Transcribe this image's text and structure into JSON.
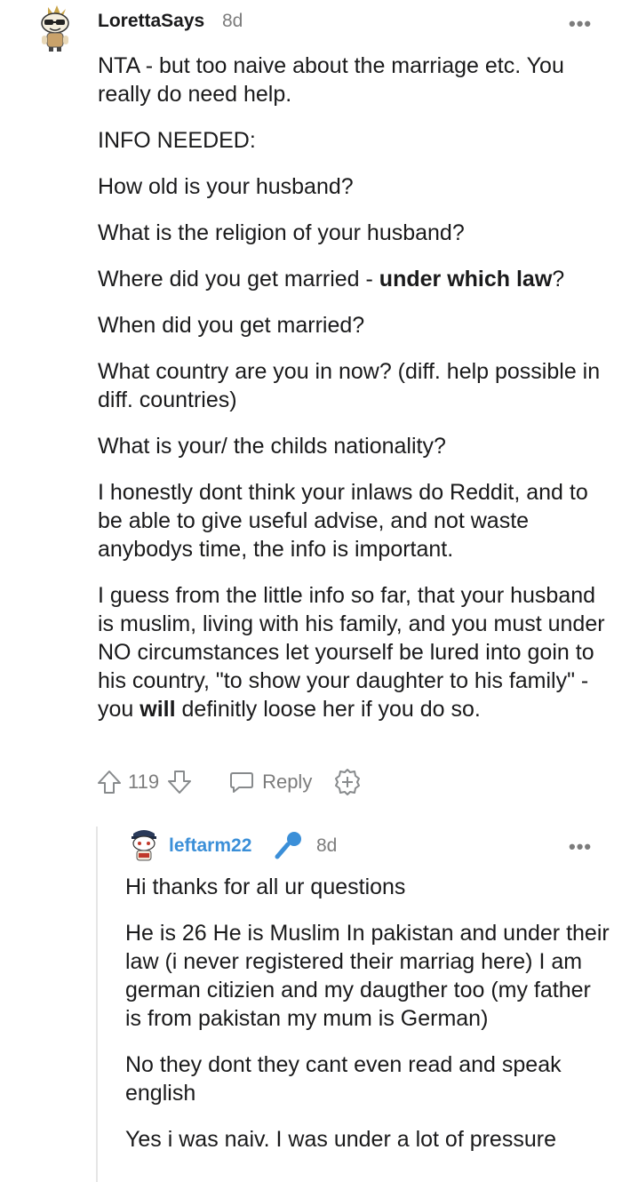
{
  "comment": {
    "author": "LorettaSays",
    "age": "8d",
    "more_label": "•••",
    "paragraphs": [
      "NTA - but too naive about the marriage etc. You really do need help.",
      "INFO NEEDED:",
      "How old is your husband?",
      "What is the religion of your husband?",
      {
        "before": "Where did you get married - ",
        "bold": "under which law",
        "after": "?"
      },
      "When did you get married?",
      "What country are you in now? (diff. help possible in diff. countries)",
      "What is your/ the childs nationality?",
      "I honestly dont think your inlaws do Reddit, and to be able to give useful advise, and not waste anybodys time, the info is important.",
      {
        "before": "I guess from the little info so far, that your husband is muslim, living with his family, and you must under NO circumstances let yourself be lured into goin to his country, \"to show your daughter to his family\" - you ",
        "bold": "will",
        "after": " definitly loose her if you do so."
      }
    ],
    "score": "119",
    "reply_label": "Reply",
    "icons": [
      "upvote-icon",
      "downvote-icon",
      "reply-icon",
      "award-icon"
    ]
  },
  "reply_comment": {
    "author": "leftarm22",
    "age": "8d",
    "more_label": "•••",
    "flair_icon": "microphone-icon",
    "paragraphs": [
      "Hi thanks for all ur questions",
      "He is 26 He is Muslim In pakistan and under their law (i never registered their marriag here) I am german citizien and my daugther too (my father is from pakistan my mum is German)",
      "No they dont they cant even read and speak english",
      "Yes i was naiv. I was under a lot of pressure"
    ]
  },
  "colors": {
    "text": "#1a1a1b",
    "meta": "#7c7c7c",
    "op_author": "#3b8fd8",
    "thread_line": "#e6e6e6"
  }
}
